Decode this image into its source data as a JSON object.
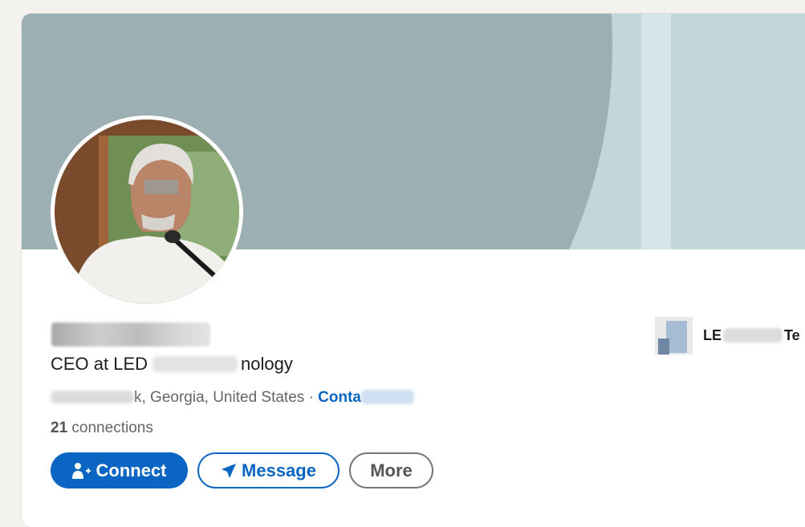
{
  "profile": {
    "headline_prefix": "CEO at LED",
    "headline_suffix": "nology",
    "location": "k, Georgia, United States",
    "separator": "·",
    "contact_info_label": "Conta",
    "connections_count": "21",
    "connections_label": "connections"
  },
  "actions": {
    "connect_label": "Connect",
    "message_label": "Message",
    "more_label": "More"
  },
  "company": {
    "name_prefix": "LE",
    "name_suffix": "Te"
  },
  "icons": {
    "connect": "user-plus-icon",
    "message": "paper-plane-icon"
  },
  "colors": {
    "brand_blue": "#0a66c2",
    "banner_dark": "#9cb0b3",
    "banner_light": "#c3d6da",
    "page_bg": "#f4f2ee"
  }
}
